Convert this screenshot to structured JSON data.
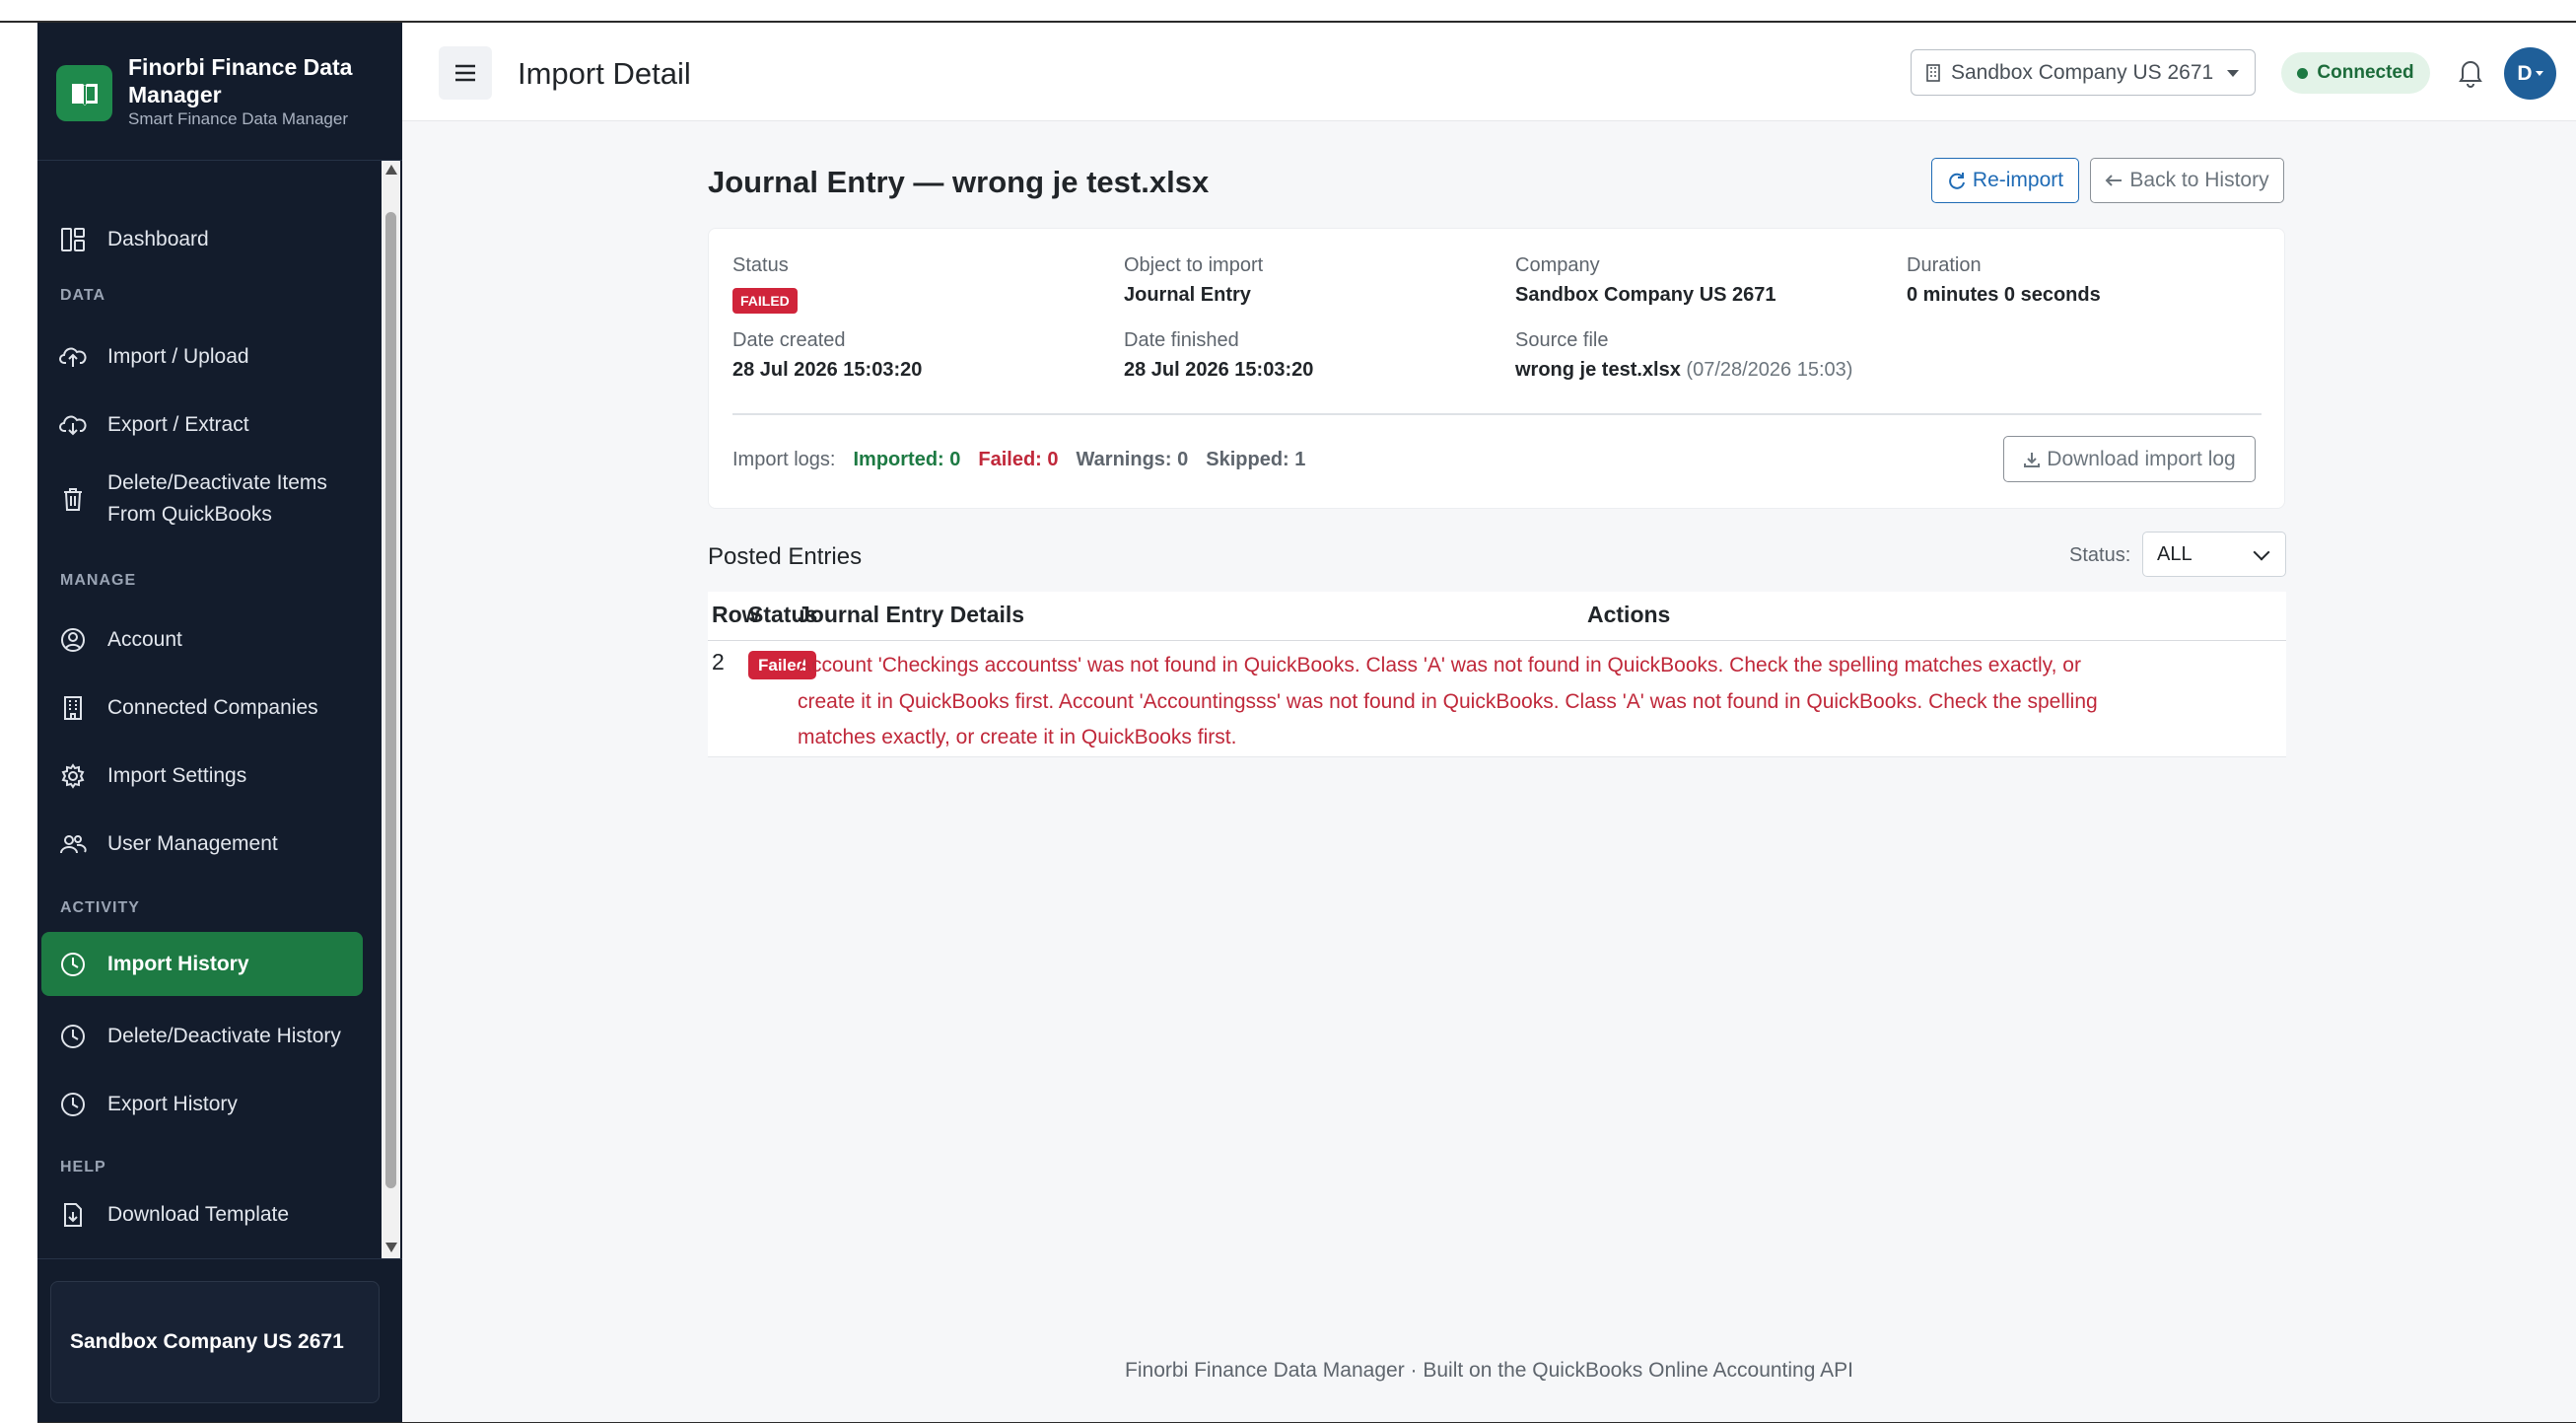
{
  "app": {
    "name": "Finorbi Finance Data Manager",
    "tagline": "Smart Finance Data Manager",
    "brand_color": "#1d7a43",
    "sidebar_bg": "#131c2c"
  },
  "sidebar": {
    "items": {
      "dashboard": "Dashboard",
      "import_upload": "Import / Upload",
      "export_extract": "Export / Extract",
      "delete_deactivate_line1": "Delete/Deactivate Items",
      "delete_deactivate_line2": "From QuickBooks",
      "account": "Account",
      "connected_companies": "Connected Companies",
      "import_settings": "Import Settings",
      "user_management": "User Management",
      "import_history": "Import History",
      "delete_history": "Delete/Deactivate History",
      "export_history": "Export History",
      "download_template": "Download Template"
    },
    "sections": {
      "data": "DATA",
      "manage": "MANAGE",
      "activity": "ACTIVITY",
      "help": "HELP"
    },
    "active_item": "Import History",
    "company_card": "Sandbox Company US 2671"
  },
  "topbar": {
    "title": "Import Detail",
    "company_select": "Sandbox Company US 2671",
    "connection_status": "Connected",
    "avatar_initial": "D"
  },
  "detail": {
    "title": "Journal Entry — wrong je test.xlsx",
    "reimport_label": "Re-import",
    "back_label": "Back to History",
    "status_label": "Status",
    "status_value": "FAILED",
    "object_label": "Object to import",
    "object_value": "Journal Entry",
    "company_label": "Company",
    "company_value": "Sandbox Company US 2671",
    "duration_label": "Duration",
    "duration_value": "0 minutes 0 seconds",
    "created_label": "Date created",
    "created_value": "28 Jul 2026 15:03:20",
    "finished_label": "Date finished",
    "finished_value": "28 Jul 2026 15:03:20",
    "source_label": "Source file",
    "source_value": "wrong je test.xlsx",
    "source_timestamp": "(07/28/2026 15:03)",
    "logs_label": "Import logs:",
    "logs_imported": "Imported: 0",
    "logs_failed": "Failed: 0",
    "logs_warnings": "Warnings: 0",
    "logs_skipped": "Skipped: 1",
    "download_log_label": "Download import log"
  },
  "posted_entries": {
    "title": "Posted Entries",
    "filter_label": "Status:",
    "filter_value": "ALL",
    "columns": {
      "row": "Row",
      "status": "Status",
      "details": "Journal Entry Details",
      "actions": "Actions"
    },
    "rows": [
      {
        "row": "2",
        "status": "Failed",
        "details": "Account 'Checkings accountss' was not found in QuickBooks. Class 'A' was not found in QuickBooks. Check the spelling matches exactly, or create it in QuickBooks first. Account 'Accountingsss' was not found in QuickBooks. Class 'A' was not found in QuickBooks. Check the spelling matches exactly, or create it in QuickBooks first."
      }
    ]
  },
  "footer": {
    "text": "Finorbi Finance Data Manager · Built on the QuickBooks Online Accounting API"
  },
  "colors": {
    "failed": "#d0243a",
    "link_blue": "#1f6bb5",
    "connected_bg": "#e3f3e8"
  }
}
